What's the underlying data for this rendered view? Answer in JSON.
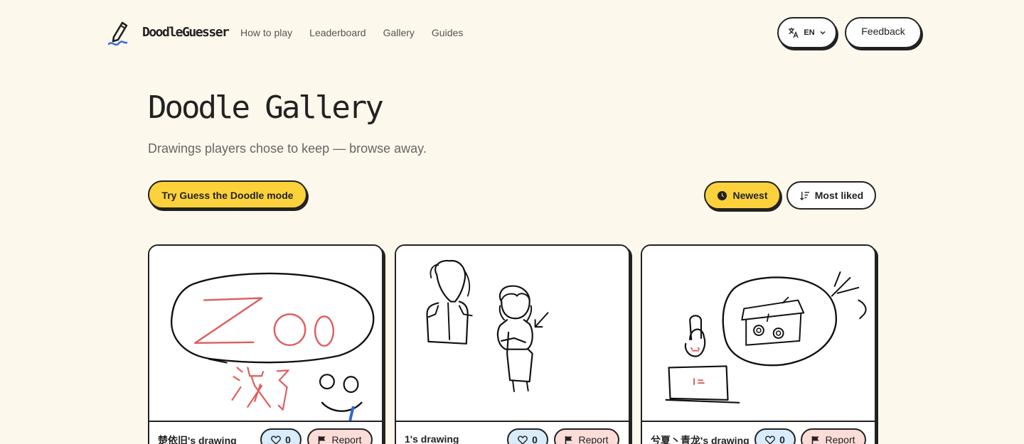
{
  "header": {
    "brand": "DoodleGuesser",
    "nav": [
      "How to play",
      "Leaderboard",
      "Gallery",
      "Guides"
    ],
    "language": "EN",
    "feedback_label": "Feedback"
  },
  "page": {
    "title": "Doodle Gallery",
    "subtitle": "Drawings players chose to keep — browse away."
  },
  "actions": {
    "try_mode_label": "Try Guess the Doodle mode",
    "sort_newest_label": "Newest",
    "sort_most_liked_label": "Most liked",
    "active_sort": "Newest"
  },
  "cards": [
    {
      "author": "楚依旧's drawing",
      "likes": "0",
      "report_label": "Report"
    },
    {
      "author": "1's drawing",
      "likes": "0",
      "report_label": "Report"
    },
    {
      "author": "兮夏丶青龙's drawing",
      "likes": "0",
      "report_label": "Report"
    }
  ],
  "drawing_texts": {
    "card1_word": "ZOO",
    "card1_chinese": "没了"
  },
  "colors": {
    "background": "#fdf8ec",
    "accent_yellow": "#fcd23c",
    "like_blue": "#d9ecfb",
    "report_pink": "#fbdcd7",
    "ink": "#222222",
    "logo_blue": "#3a6fd8"
  },
  "icons": {
    "logo": "pen-doodle-icon",
    "language": "translate-icon",
    "chevron": "chevron-down-icon",
    "newest": "clock-icon",
    "most_liked": "sort-descending-icon",
    "like": "heart-icon",
    "report": "flag-icon"
  }
}
